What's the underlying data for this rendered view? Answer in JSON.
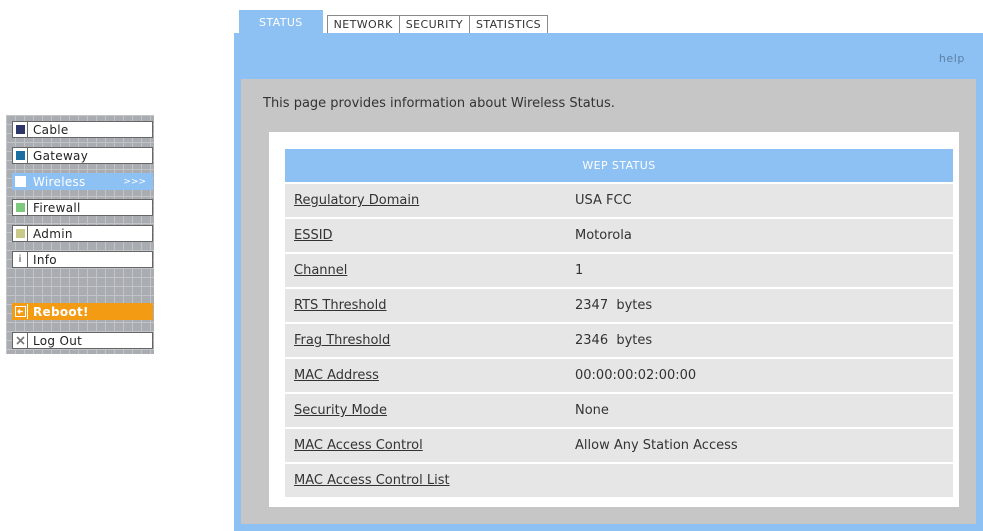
{
  "sidebar": {
    "items": [
      {
        "label": "Cable",
        "swatch": "#2e3567"
      },
      {
        "label": "Gateway",
        "swatch": "#1a6ea0"
      },
      {
        "label": "Wireless",
        "swatch": "#ffffff",
        "active": true,
        "arrows": ">>>"
      },
      {
        "label": "Firewall",
        "swatch": "#7ec97e"
      },
      {
        "label": "Admin",
        "swatch": "#c9c98a"
      },
      {
        "label": "Info",
        "glyph": "i"
      },
      {
        "label": "Reboot!",
        "icon": "arrow-left-icon"
      },
      {
        "label": "Log Out",
        "icon": "close-icon"
      }
    ]
  },
  "tabs": [
    "STATUS",
    "NETWORK",
    "SECURITY",
    "STATISTICS"
  ],
  "help_label": "help",
  "intro_text": "This page provides information about Wireless Status.",
  "status_table": {
    "header": "WEP STATUS",
    "rows": [
      {
        "label": "Regulatory Domain",
        "value": "USA FCC"
      },
      {
        "label": "ESSID",
        "value": "Motorola"
      },
      {
        "label": "Channel",
        "value": "1"
      },
      {
        "label": "RTS Threshold",
        "value": "2347  bytes"
      },
      {
        "label": "Frag Threshold",
        "value": "2346  bytes"
      },
      {
        "label": "MAC Address",
        "value": "00:00:00:02:00:00"
      },
      {
        "label": "Security Mode",
        "value": "None"
      },
      {
        "label": "MAC Access Control",
        "value": "Allow Any Station Access"
      },
      {
        "label": "MAC Access Control List",
        "value": ""
      }
    ]
  },
  "colors": {
    "accent_blue": "#8dc0f3",
    "reboot_orange": "#f49b14",
    "content_gray": "#c6c6c6"
  }
}
